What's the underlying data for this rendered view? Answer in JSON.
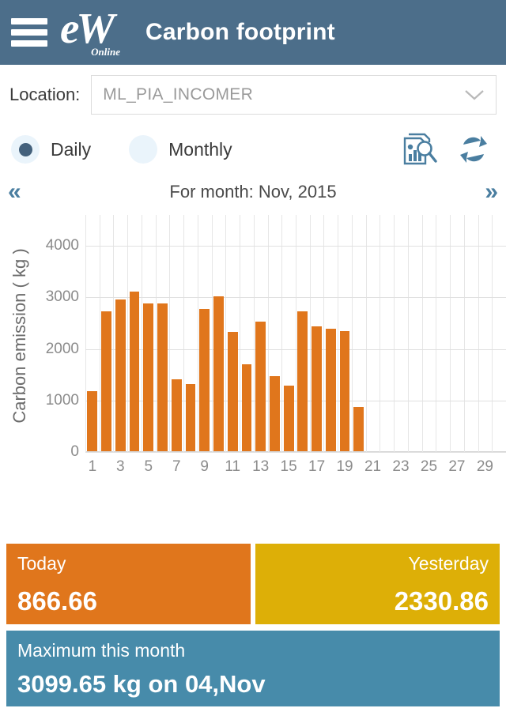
{
  "header": {
    "menu_icon": "hamburger-menu-icon",
    "logo_text": "eW",
    "logo_sub": "Online",
    "title": "Carbon footprint"
  },
  "location": {
    "label": "Location:",
    "selected": "ML_PIA_INCOMER",
    "chevron_icon": "chevron-down-icon"
  },
  "mode": {
    "options": [
      {
        "label": "Daily",
        "checked": true
      },
      {
        "label": "Monthly",
        "checked": false
      }
    ],
    "report_icon": "report-search-icon",
    "refresh_icon": "refresh-sync-icon"
  },
  "month_nav": {
    "prev": "«",
    "next": "»",
    "title": "For month: Nov, 2015"
  },
  "cards": {
    "today_label": "Today",
    "today_value": "866.66",
    "yesterday_label": "Yesterday",
    "yesterday_value": "2330.86",
    "max_label": "Maximum this month",
    "max_value": "3099.65 kg on 04,Nov"
  },
  "colors": {
    "header": "#4c6e8a",
    "bar": "#e0761c",
    "today_card": "#e0761c",
    "yesterday_card": "#ddaf07",
    "max_card": "#478baa",
    "accent": "#4a7ea0"
  },
  "chart_data": {
    "type": "bar",
    "title": "For month: Nov, 2015",
    "xlabel": "",
    "ylabel": "Carbon emission ( kg )",
    "ylim": [
      0,
      4600
    ],
    "yticks": [
      0,
      1000,
      2000,
      3000,
      4000
    ],
    "ytick_labels": [
      "0",
      "1000",
      "2000",
      "3000",
      "4000"
    ],
    "grid": true,
    "legend": "none",
    "categories": [
      1,
      2,
      3,
      4,
      5,
      6,
      7,
      8,
      9,
      10,
      11,
      12,
      13,
      14,
      15,
      16,
      17,
      18,
      19,
      20,
      21,
      22,
      23,
      24,
      25,
      26,
      27,
      28,
      29,
      30
    ],
    "xtick_labels": [
      "1",
      "3",
      "5",
      "7",
      "9",
      "11",
      "13",
      "15",
      "17",
      "19",
      "21",
      "23",
      "25",
      "27",
      "29"
    ],
    "values": [
      1160,
      2720,
      2940,
      3100,
      2870,
      2870,
      1400,
      1300,
      2760,
      3010,
      2320,
      1680,
      2520,
      1450,
      1270,
      2710,
      2420,
      2380,
      2330,
      866,
      null,
      null,
      null,
      null,
      null,
      null,
      null,
      null,
      null,
      null
    ]
  }
}
